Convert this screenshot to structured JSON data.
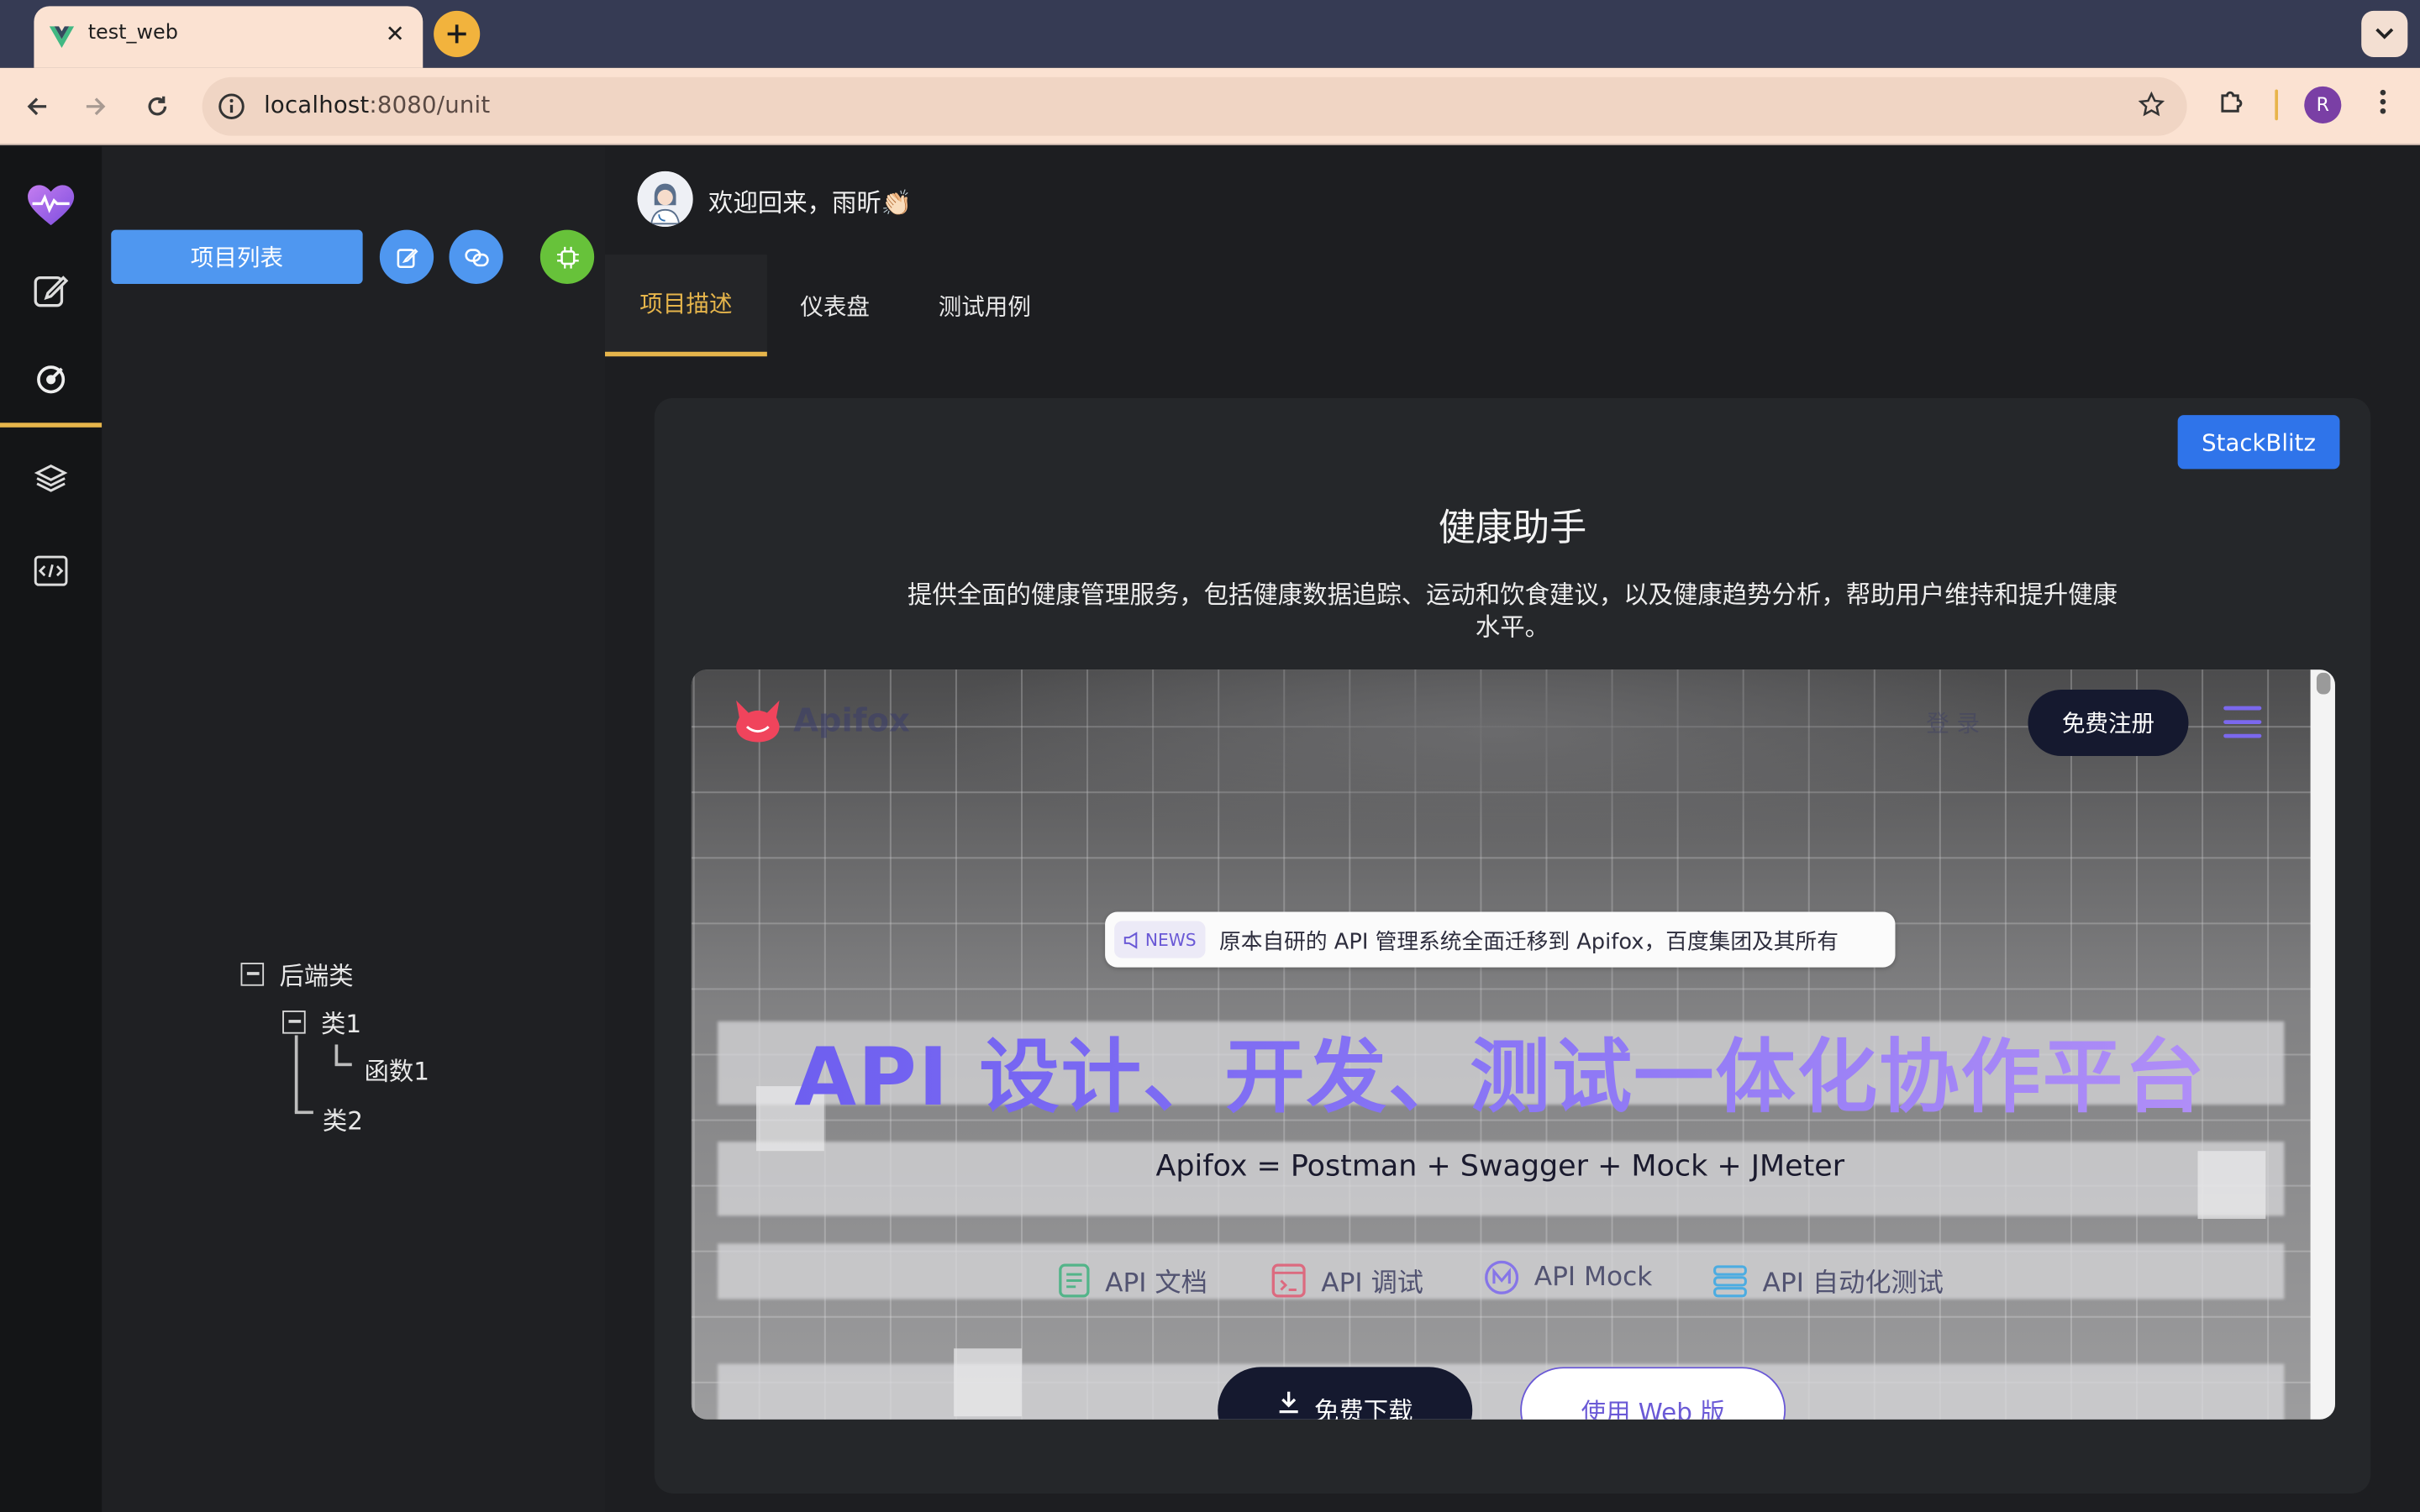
{
  "browser": {
    "tab_title": "test_web",
    "url_host": "localhost",
    "url_path": ":8080/unit",
    "profile_initial": "R"
  },
  "sidebar_rail": {
    "items": [
      {
        "icon": "heart-pulse-icon"
      },
      {
        "icon": "edit-icon"
      },
      {
        "icon": "target-icon",
        "active": true
      },
      {
        "icon": "layers-icon"
      },
      {
        "icon": "code-icon"
      }
    ]
  },
  "panel": {
    "project_list_label": "项目列表",
    "tree": {
      "root": "后端类",
      "class1": "类1",
      "func1": "函数1",
      "class2": "类2"
    }
  },
  "header": {
    "welcome": "欢迎回来，雨昕👏🏻"
  },
  "tabs": [
    {
      "label": "项目描述",
      "active": true
    },
    {
      "label": "仪表盘"
    },
    {
      "label": "测试用例"
    }
  ],
  "card": {
    "stackblitz_label": "StackBlitz",
    "title": "健康助手",
    "description": "提供全面的健康管理服务，包括健康数据追踪、运动和饮食建议，以及健康趋势分析，帮助用户维持和提升健康水平。"
  },
  "embed": {
    "brand": "Apifox",
    "login": "登 录",
    "register": "免费注册",
    "news_tag": "NEWS",
    "news_text": "原本自研的 API 管理系统全面迁移到 Apifox，百度集团及其所有",
    "hero_title": "API 设计、开发、测试一体化协作平台",
    "hero_subtitle": "Apifox = Postman + Swagger + Mock + JMeter",
    "features": [
      "API 文档",
      "API 调试",
      "API Mock",
      "API 自动化测试"
    ],
    "download": "免费下载",
    "web_version": "使用 Web 版"
  },
  "colors": {
    "accent": "#e6b54b",
    "primary_blue": "#4f97f0",
    "stackblitz_blue": "#2f74ea",
    "apifox_purple": "#7b68ee"
  }
}
